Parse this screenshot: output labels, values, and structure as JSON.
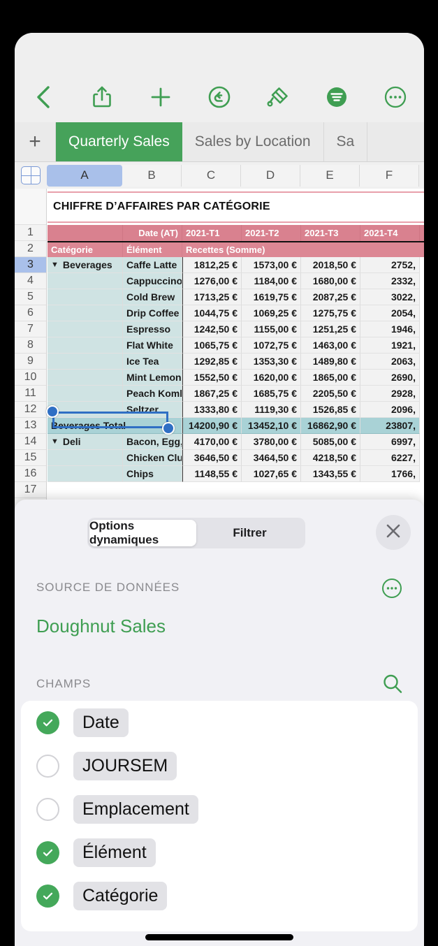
{
  "app": {
    "name": "Numbers"
  },
  "toolbar": {
    "back": "back-chevron",
    "items": [
      {
        "name": "back-button",
        "icon": "chevron-left-icon"
      },
      {
        "name": "share-button",
        "icon": "share-icon"
      },
      {
        "name": "insert-button",
        "icon": "plus-icon"
      },
      {
        "name": "undo-button",
        "icon": "undo-icon"
      },
      {
        "name": "format-button",
        "icon": "paintbrush-icon"
      },
      {
        "name": "organize-button",
        "icon": "filter-icon"
      },
      {
        "name": "more-button",
        "icon": "ellipsis-circle-icon"
      }
    ]
  },
  "tabbar": {
    "add_label": "+",
    "tabs": [
      {
        "label": "Quarterly Sales",
        "active": true
      },
      {
        "label": "Sales by Location",
        "active": false
      },
      {
        "label": "Sa",
        "active": false
      }
    ]
  },
  "grid": {
    "corner_icon": "insert-table-icon",
    "columns": [
      "A",
      "B",
      "C",
      "D",
      "E",
      "F"
    ],
    "selected_column": "A",
    "rows": [
      "1",
      "2",
      "3",
      "4",
      "5",
      "6",
      "7",
      "8",
      "9",
      "10",
      "11",
      "12",
      "13",
      "14",
      "15",
      "16",
      "17"
    ],
    "selected_row": "3",
    "table_title": "CHIFFRE D’AFFAIRES PAR CATÉGORIE",
    "header_row_1": [
      "",
      "Date (AT)",
      "2021-T1",
      "2021-T2",
      "2021-T3",
      "2021-T4"
    ],
    "header_row_2": [
      "Catégorie",
      "Élément",
      "Recettes (Somme)",
      "",
      "",
      ""
    ],
    "data_rows": [
      {
        "row": "3",
        "category": "Beverages",
        "disclosure": true,
        "item": "Caffe Latte",
        "t1": "1812,25 €",
        "t2": "1573,00 €",
        "t3": "2018,50 €",
        "t4": "2752,"
      },
      {
        "row": "4",
        "category": "",
        "disclosure": false,
        "item": "Cappuccino",
        "t1": "1276,00 €",
        "t2": "1184,00 €",
        "t3": "1680,00 €",
        "t4": "2332,"
      },
      {
        "row": "5",
        "category": "",
        "disclosure": false,
        "item": "Cold Brew",
        "t1": "1713,25 €",
        "t2": "1619,75 €",
        "t3": "2087,25 €",
        "t4": "3022,"
      },
      {
        "row": "6",
        "category": "",
        "disclosure": false,
        "item": "Drip Coffee",
        "t1": "1044,75 €",
        "t2": "1069,25 €",
        "t3": "1275,75 €",
        "t4": "2054,"
      },
      {
        "row": "7",
        "category": "",
        "disclosure": false,
        "item": "Espresso",
        "t1": "1242,50 €",
        "t2": "1155,00 €",
        "t3": "1251,25 €",
        "t4": "1946,"
      },
      {
        "row": "8",
        "category": "",
        "disclosure": false,
        "item": "Flat White",
        "t1": "1065,75 €",
        "t2": "1072,75 €",
        "t3": "1463,00 €",
        "t4": "1921,"
      },
      {
        "row": "9",
        "category": "",
        "disclosure": false,
        "item": "Ice Tea",
        "t1": "1292,85 €",
        "t2": "1353,30 €",
        "t3": "1489,80 €",
        "t4": "2063,"
      },
      {
        "row": "10",
        "category": "",
        "disclosure": false,
        "item": "Mint Lemonade",
        "t1": "1552,50 €",
        "t2": "1620,00 €",
        "t3": "1865,00 €",
        "t4": "2690,"
      },
      {
        "row": "11",
        "category": "",
        "disclosure": false,
        "item": "Peach Kombucha",
        "t1": "1867,25 €",
        "t2": "1685,75 €",
        "t3": "2205,50 €",
        "t4": "2928,"
      },
      {
        "row": "12",
        "category": "",
        "disclosure": false,
        "item": "Seltzer",
        "t1": "1333,80 €",
        "t2": "1119,30 €",
        "t3": "1526,85 €",
        "t4": "2096,"
      },
      {
        "row": "13",
        "category": "Beverages Total",
        "disclosure": false,
        "total": true,
        "item": "",
        "t1": "14200,90 €",
        "t2": "13452,10 €",
        "t3": "16862,90 €",
        "t4": "23807,"
      },
      {
        "row": "14",
        "category": "Deli",
        "disclosure": true,
        "item": "Bacon, Egg, Cheese",
        "t1": "4170,00 €",
        "t2": "3780,00 €",
        "t3": "5085,00 €",
        "t4": "6997,"
      },
      {
        "row": "15",
        "category": "",
        "disclosure": false,
        "item": "Chicken Club",
        "t1": "3646,50 €",
        "t2": "3464,50 €",
        "t3": "4218,50 €",
        "t4": "6227,"
      },
      {
        "row": "16",
        "category": "",
        "disclosure": false,
        "item": "Chips",
        "t1": "1148,55 €",
        "t2": "1027,65 €",
        "t3": "1343,55 €",
        "t4": "1766,"
      }
    ]
  },
  "sheet": {
    "segments": [
      {
        "label": "Options dynamiques",
        "active": true
      },
      {
        "label": "Filtrer",
        "active": false
      }
    ],
    "close_icon": "close-icon",
    "data_source": {
      "label": "SOURCE DE DONNÉES",
      "more_icon": "ellipsis-circle-icon",
      "name": "Doughnut Sales"
    },
    "fields": {
      "label": "CHAMPS",
      "search_icon": "search-icon",
      "items": [
        {
          "label": "Date",
          "checked": true
        },
        {
          "label": "JOURSEM",
          "checked": false
        },
        {
          "label": "Emplacement",
          "checked": false
        },
        {
          "label": "Élément",
          "checked": true
        },
        {
          "label": "Catégorie",
          "checked": true
        }
      ]
    }
  },
  "colors": {
    "accent_green": "#3f9e52",
    "tab_active": "#46a25a",
    "header_pink": "#d9818f",
    "category_teal": "#cfe3e3",
    "total_teal": "#a9d2d6",
    "selection_blue": "#2f6fc4",
    "column_selected": "#a9c0ea"
  }
}
